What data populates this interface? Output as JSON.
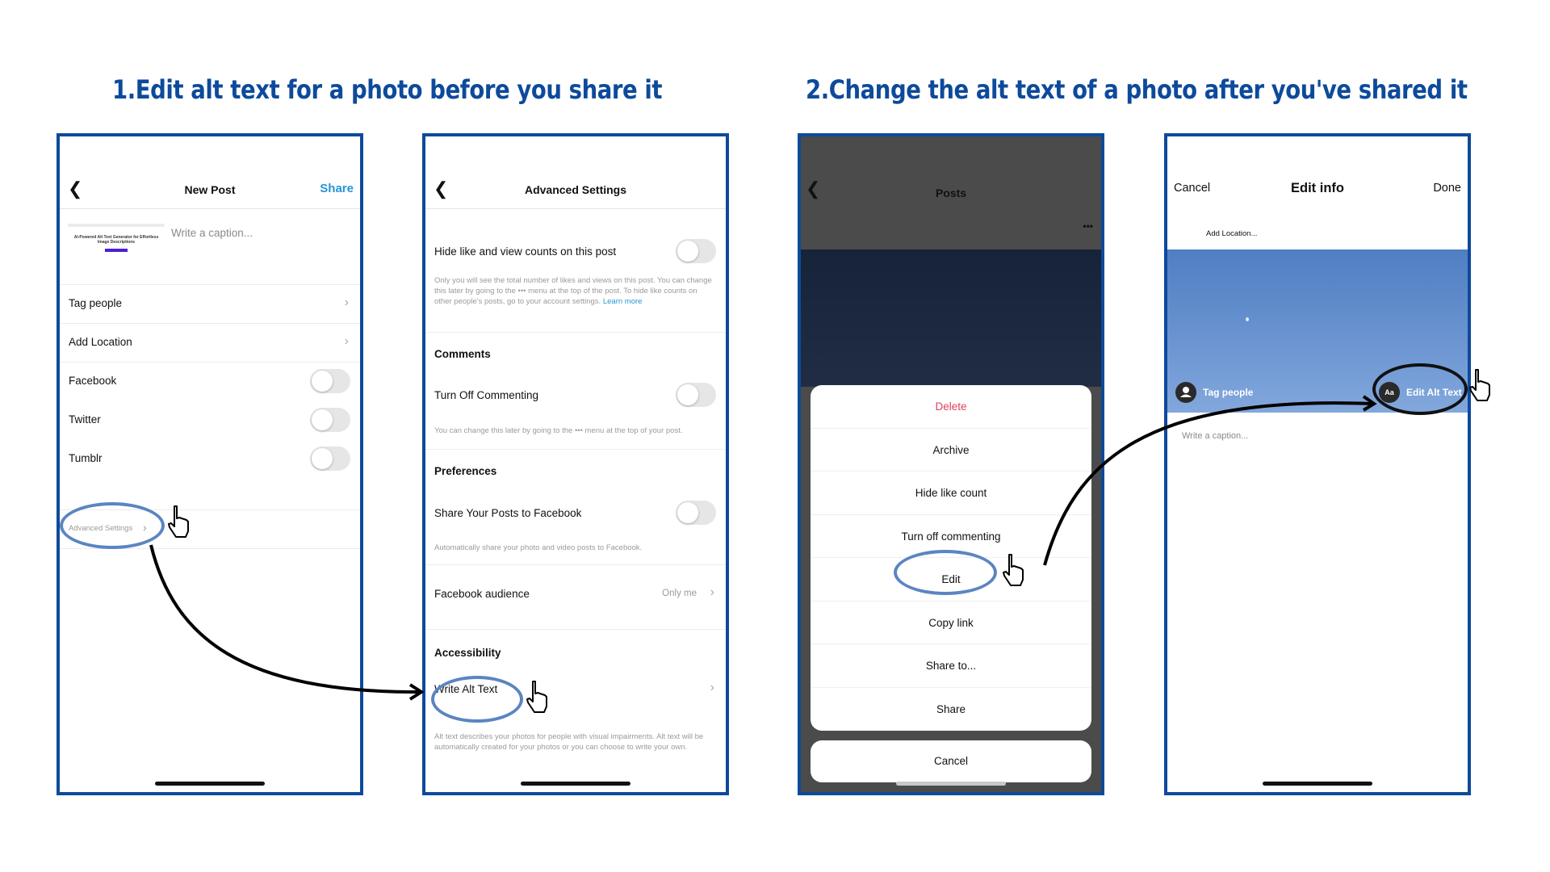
{
  "sections": [
    {
      "title": "1.Edit alt text for a photo before you share it"
    },
    {
      "title": "2.Change the alt text of a photo after you've shared it"
    }
  ],
  "panel1": {
    "nav": {
      "title": "New Post",
      "action": "Share"
    },
    "thumbnail_text": "AI-Powered Alt Text Generator for Effortless Image Descriptions",
    "caption_placeholder": "Write a caption...",
    "rows": [
      {
        "label": "Tag people",
        "type": "link"
      },
      {
        "label": "Add Location",
        "type": "link"
      },
      {
        "label": "Facebook",
        "type": "toggle",
        "on": false
      },
      {
        "label": "Twitter",
        "type": "toggle",
        "on": false
      },
      {
        "label": "Tumblr",
        "type": "toggle",
        "on": false
      }
    ],
    "advanced_settings": "Advanced Settings"
  },
  "panel2": {
    "nav": {
      "title": "Advanced Settings"
    },
    "hide_counts": {
      "label": "Hide like and view counts on this post",
      "on": false,
      "note": "Only you will see the total number of likes and views on this post. You can change this later by going to the ••• menu at the top of the post. To hide like counts on other people's posts, go to your account settings.",
      "link": "Learn more"
    },
    "comments": {
      "heading": "Comments",
      "label": "Turn Off Commenting",
      "on": false,
      "note": "You can change this later by going to the ••• menu at the top of your post."
    },
    "preferences": {
      "heading": "Preferences",
      "label": "Share Your Posts to Facebook",
      "on": false,
      "note": "Automatically share your photo and video posts to Facebook."
    },
    "facebook_audience": {
      "label": "Facebook audience",
      "value": "Only me"
    },
    "accessibility": {
      "heading": "Accessibility",
      "label": "Write Alt Text",
      "note": "Alt text describes your photos for people with visual impairments. Alt text will be automatically created for your photos or you can choose to write your own."
    }
  },
  "panel3": {
    "nav": {
      "title": "Posts",
      "more": "•••"
    },
    "sheet_items": [
      "Delete",
      "Archive",
      "Hide like count",
      "Turn off commenting",
      "Edit",
      "Copy link",
      "Share to...",
      "Share"
    ],
    "cancel": "Cancel"
  },
  "panel4": {
    "nav": {
      "cancel": "Cancel",
      "title": "Edit info",
      "done": "Done"
    },
    "add_location": "Add Location...",
    "tag_people": "Tag people",
    "alt_icon": "Aa",
    "edit_alt_text": "Edit Alt Text",
    "caption_placeholder": "Write a caption..."
  },
  "colors": {
    "accent": "#0d4a9b",
    "link": "#2795d6",
    "danger": "#e0405e",
    "highlight_oval": "#5b85c1"
  }
}
